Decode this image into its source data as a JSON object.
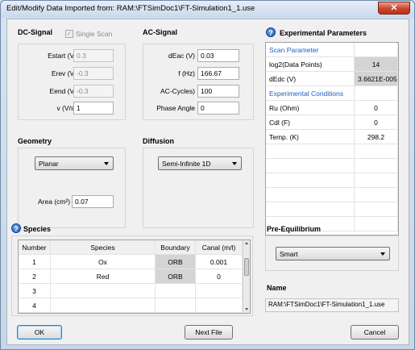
{
  "window": {
    "title": "Edit/Modify Data Imported from:  RAM:\\FTSimDoc1\\FT-Simulation1_1.use",
    "close_label": "✕"
  },
  "dc_signal": {
    "title": "DC-Signal",
    "single_scan_label": "Single Scan",
    "single_scan_checked": true,
    "fields": [
      {
        "label": "Estart (V)",
        "value": "0.3",
        "disabled": true
      },
      {
        "label": "Erev (V)",
        "value": "-0.3",
        "disabled": true
      },
      {
        "label": "Eend (V)",
        "value": "-0.3",
        "disabled": true
      },
      {
        "label": "v (V/s)",
        "value": "1",
        "disabled": false
      }
    ]
  },
  "ac_signal": {
    "title": "AC-Signal",
    "fields": [
      {
        "label": "dEac (V)",
        "value": "0.03"
      },
      {
        "label": "f (Hz)",
        "value": "166.67"
      },
      {
        "label": "AC-Cycles)",
        "value": "100"
      },
      {
        "label": "Phase Angle",
        "value": "0"
      }
    ]
  },
  "experimental": {
    "title": "Experimental Parameters",
    "rows": [
      {
        "name": "Scan Parameter",
        "value": "",
        "section": true
      },
      {
        "name": "log2(Data Points)",
        "value": "14",
        "grey": true
      },
      {
        "name": "dEdc (V)",
        "value": "3.6621E-005",
        "grey": true
      },
      {
        "name": "Experimental Conditions",
        "value": "",
        "section": true
      },
      {
        "name": "Ru (Ohm)",
        "value": "0"
      },
      {
        "name": "Cdl (F)",
        "value": "0"
      },
      {
        "name": "Temp. (K)",
        "value": "298.2"
      }
    ]
  },
  "geometry": {
    "title": "Geometry",
    "selected": "Planar",
    "area_label": "Area (cm²)",
    "area_value": "0.07"
  },
  "diffusion": {
    "title": "Diffusion",
    "selected": "Semi-Infinite 1D"
  },
  "species": {
    "title": "Species",
    "headers": [
      "Number",
      "Species",
      "Boundary",
      "Canal (m/l)"
    ],
    "rows": [
      [
        "1",
        "Ox",
        "ORB",
        "0.001"
      ],
      [
        "2",
        "Red",
        "ORB",
        "0"
      ],
      [
        "3",
        "",
        "",
        ""
      ],
      [
        "4",
        "",
        "",
        ""
      ]
    ]
  },
  "pre_equilibrium": {
    "title": "Pre-Equilibrium",
    "selected": "Smart"
  },
  "name_section": {
    "title": "Name",
    "value": "RAM:\\FTSimDoc1\\FT-Simulation1_1.use"
  },
  "buttons": {
    "ok": "OK",
    "next_file": "Next File",
    "cancel": "Cancel"
  },
  "icons": {
    "help": "?"
  },
  "colors": {
    "accent": "#1f5fbf",
    "help_icon": "#1d56b9",
    "grey_cell": "#d4d4d4"
  }
}
